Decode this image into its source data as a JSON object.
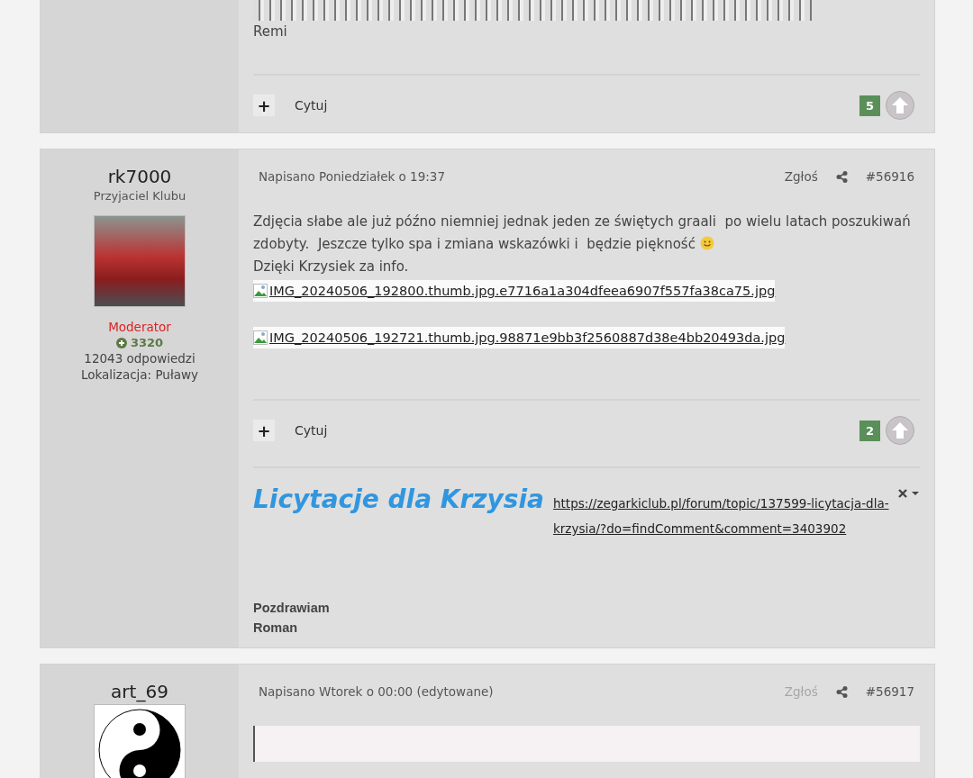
{
  "posts": [
    {
      "body": [
        {
          "kind": "photo"
        },
        {
          "kind": "text",
          "text": "Remi"
        }
      ],
      "footer": {
        "multiquote": "+",
        "quote": "Cytuj",
        "count": "5"
      }
    },
    {
      "author": {
        "name": "rk7000",
        "group": "Przyjaciel Klubu",
        "avatar": {
          "kind": "photo"
        },
        "role": "Moderator",
        "reputation": "3320",
        "posts": "12043 odpowiedzi",
        "location": "Lokalizacja: Puławy"
      },
      "meta": {
        "posted": "Napisano Poniedziałek o 19:37",
        "report": "Zgłoś",
        "report_disabled": false,
        "number": "#56916"
      },
      "body": [
        {
          "kind": "paragraph",
          "lines": [
            "Zdjęcia słabe ale już późno niemniej jednak jeden ze świętych graali  po wielu latach poszukiwań",
            "zdobyty.  Jeszcze tylko spa i zmiana wskazówki i  będzie piękność"
          ],
          "emoji": {
            "kind": "smiley"
          }
        },
        {
          "kind": "text",
          "text": "Dzięki Krzysiek za info."
        },
        {
          "kind": "image_link",
          "text": "IMG_20240506_192800.thumb.jpg.e7716a1a304dfeea6907f557fa38ca75.jpg"
        },
        {
          "kind": "image_link",
          "text": "IMG_20240506_192721.thumb.jpg.98871e9bb3f2560887d38e4bb20493da.jpg"
        }
      ],
      "footer": {
        "multiquote": "+",
        "quote": "Cytuj",
        "count": "2"
      },
      "signature": {
        "title": "Licytacje dla Krzysia",
        "link": "https://zegarkiclub.pl/forum/topic/137599-licytacja-dla-krzysia/?do=findComment&comment=3403902",
        "lines": [
          "Pozdrawiam",
          "Roman"
        ]
      }
    },
    {
      "author": {
        "name": "art_69",
        "avatar": {
          "kind": "yin_yang"
        }
      },
      "meta": {
        "posted": "Napisano Wtorek o 00:00 (edytowane)",
        "report": "Zgłoś",
        "report_disabled": true,
        "number": "#56917"
      },
      "body": [
        {
          "kind": "quote"
        }
      ]
    }
  ]
}
